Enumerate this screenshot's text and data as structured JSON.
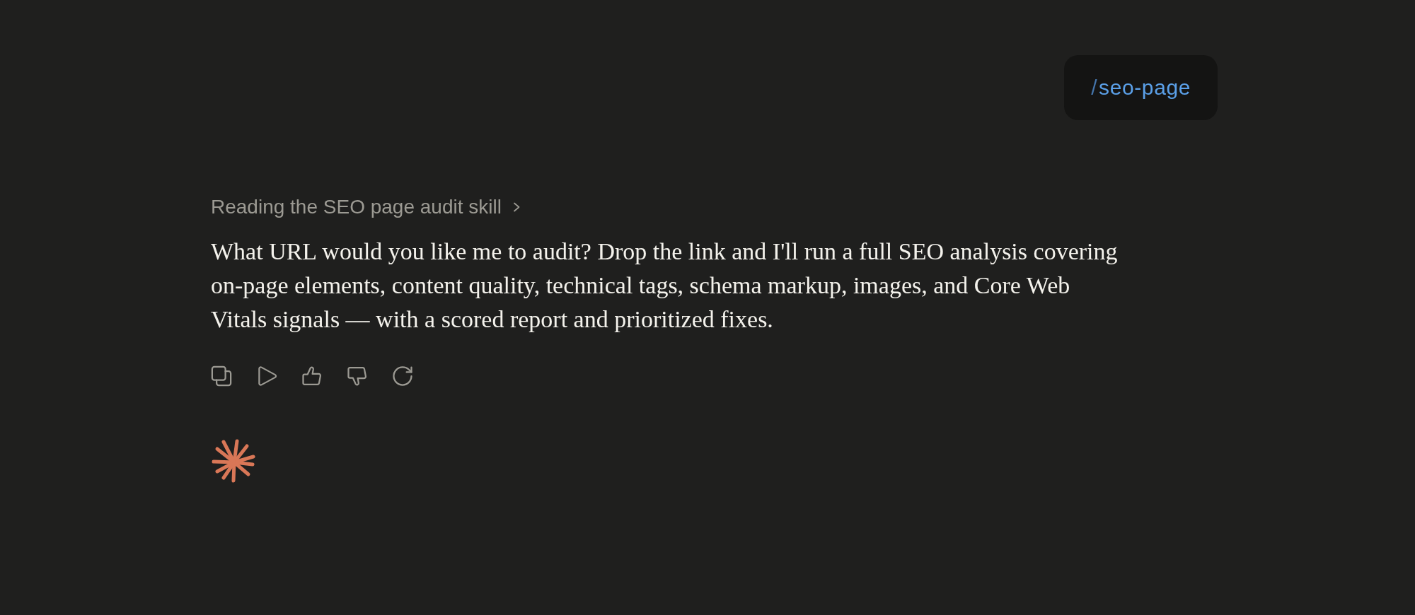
{
  "user_message": {
    "command_prefix": "/",
    "command": "seo-page"
  },
  "assistant": {
    "skill_status": {
      "label": "Reading the SEO page audit skill",
      "expanded": false
    },
    "text": "What URL would you like me to audit? Drop the link and I'll run a full SEO analysis covering on-page elements, content quality, technical tags, schema markup, images, and Core Web Vitals signals — with a scored report and prioritized fixes."
  }
}
